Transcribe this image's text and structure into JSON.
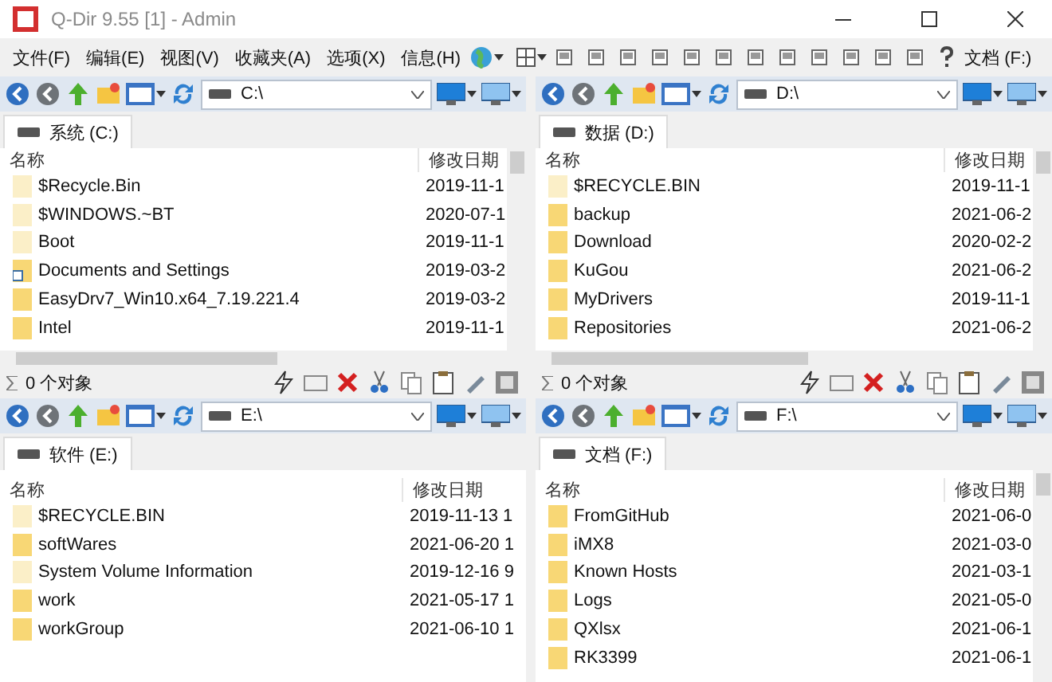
{
  "window": {
    "title": "Q-Dir 9.55 [1] - Admin"
  },
  "menu": [
    "文件(F)",
    "编辑(E)",
    "视图(V)",
    "收藏夹(A)",
    "选项(X)",
    "信息(H)"
  ],
  "drive_menu": "文档 (F:)",
  "panes": [
    {
      "address": "C:\\",
      "tab": "系统 (C:)",
      "columns": [
        "名称",
        "修改日期"
      ],
      "vertical_scrollbar": true,
      "status": "0 个对象",
      "rows": [
        {
          "name": "$Recycle.Bin",
          "date": "2019-11-1",
          "kind": "hidden"
        },
        {
          "name": "$WINDOWS.~BT",
          "date": "2020-07-1",
          "kind": "hidden"
        },
        {
          "name": "Boot",
          "date": "2019-11-1",
          "kind": "hidden"
        },
        {
          "name": "Documents and Settings",
          "date": "2019-03-2",
          "kind": "shortcut"
        },
        {
          "name": "EasyDrv7_Win10.x64_7.19.221.4",
          "date": "2019-03-2",
          "kind": "folder"
        },
        {
          "name": "Intel",
          "date": "2019-11-1",
          "kind": "folder"
        }
      ]
    },
    {
      "address": "D:\\",
      "tab": "数据 (D:)",
      "columns": [
        "名称",
        "修改日期"
      ],
      "vertical_scrollbar": true,
      "status": "0 个对象",
      "rows": [
        {
          "name": "$RECYCLE.BIN",
          "date": "2019-11-1",
          "kind": "hidden"
        },
        {
          "name": "backup",
          "date": "2021-06-2",
          "kind": "folder"
        },
        {
          "name": "Download",
          "date": "2020-02-2",
          "kind": "folder"
        },
        {
          "name": "KuGou",
          "date": "2021-06-2",
          "kind": "folder"
        },
        {
          "name": "MyDrivers",
          "date": "2019-11-1",
          "kind": "folder"
        },
        {
          "name": "Repositories",
          "date": "2021-06-2",
          "kind": "folder"
        }
      ]
    },
    {
      "address": "E:\\",
      "tab": "软件 (E:)",
      "columns": [
        "名称",
        "修改日期"
      ],
      "vertical_scrollbar": false,
      "rows": [
        {
          "name": "$RECYCLE.BIN",
          "date": "2019-11-13 1",
          "kind": "hidden"
        },
        {
          "name": "softWares",
          "date": "2021-06-20 1",
          "kind": "folder"
        },
        {
          "name": "System Volume Information",
          "date": "2019-12-16 9",
          "kind": "hidden"
        },
        {
          "name": "work",
          "date": "2021-05-17 1",
          "kind": "folder"
        },
        {
          "name": "workGroup",
          "date": "2021-06-10 1",
          "kind": "folder"
        }
      ]
    },
    {
      "address": "F:\\",
      "tab": "文档 (F:)",
      "columns": [
        "名称",
        "修改日期"
      ],
      "vertical_scrollbar": true,
      "rows": [
        {
          "name": "FromGitHub",
          "date": "2021-06-0",
          "kind": "folder"
        },
        {
          "name": "iMX8",
          "date": "2021-03-0",
          "kind": "folder"
        },
        {
          "name": "Known Hosts",
          "date": "2021-03-1",
          "kind": "folder"
        },
        {
          "name": "Logs",
          "date": "2021-05-0",
          "kind": "folder"
        },
        {
          "name": "QXlsx",
          "date": "2021-06-1",
          "kind": "folder"
        },
        {
          "name": "RK3399",
          "date": "2021-06-1",
          "kind": "folder"
        }
      ]
    }
  ]
}
